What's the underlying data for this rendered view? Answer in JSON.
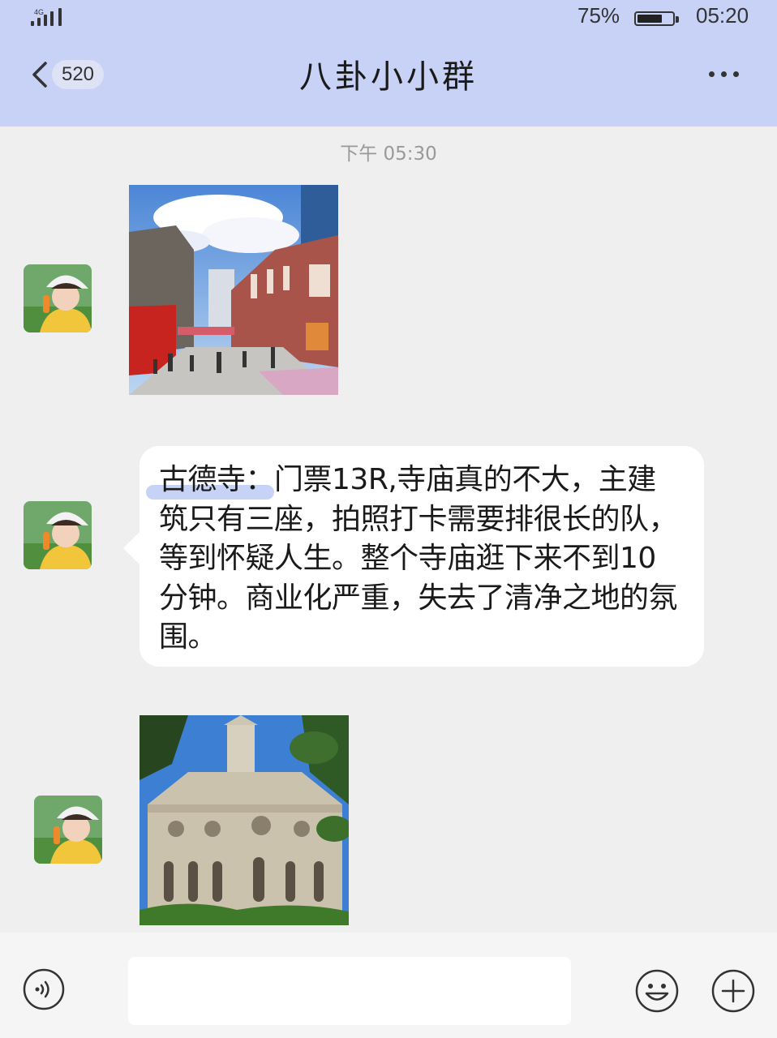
{
  "status_bar": {
    "network": "4G",
    "battery_percent": "75%",
    "battery_level": 0.75,
    "time": "05:20"
  },
  "header": {
    "back_count": "520",
    "title": "八卦小小群",
    "more_icon": "more-dots-icon"
  },
  "chat": {
    "timestamp": "下午 05:30",
    "messages": [
      {
        "type": "image",
        "description_icon": "street-photo"
      },
      {
        "type": "text",
        "highlight": "古德寺：",
        "body": "门票13R,寺庙真的不大，主建筑只有三座，拍照打卡需要排很长的队，等到怀疑人生。整个寺庙逛下来不到10分钟。商业化严重，失去了清净之地的氛围。"
      },
      {
        "type": "image",
        "description_icon": "temple-photo"
      }
    ]
  },
  "input_bar": {
    "voice_icon": "voice-icon",
    "input_value": "",
    "emoji_icon": "emoji-icon",
    "plus_icon": "plus-icon"
  },
  "colors": {
    "header_bg": "#c8d2f7",
    "chat_bg": "#efefef",
    "bubble_bg": "#ffffff",
    "highlight": "#c7d3f6"
  }
}
